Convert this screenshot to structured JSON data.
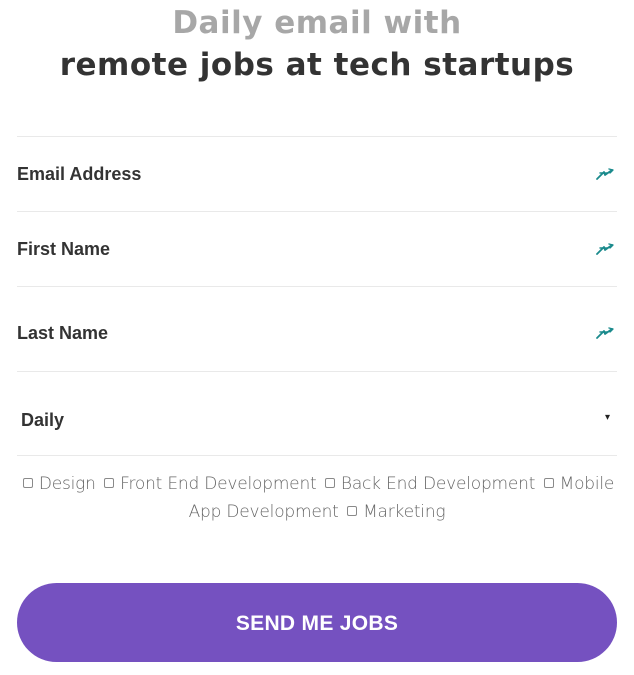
{
  "heading": {
    "line1": "Daily email with",
    "line2": "remote jobs at tech startups"
  },
  "form": {
    "email_label": "Email Address",
    "first_name_label": "First Name",
    "last_name_label": "Last Name",
    "frequency_value": "Daily",
    "frequency_arrow": "▾",
    "autofill_icon": "lastpass-autofill-icon"
  },
  "categories": [
    {
      "label": "Design"
    },
    {
      "label": "Front End Development"
    },
    {
      "label": "Back End Development"
    },
    {
      "label": "Mobile App Development"
    },
    {
      "label": "Marketing"
    }
  ],
  "submit_label": "SEND ME JOBS",
  "colors": {
    "accent": "#7551c0",
    "icon": "#1a8a8c",
    "heading_muted": "#a7a7a7",
    "heading_dark": "#333333"
  }
}
